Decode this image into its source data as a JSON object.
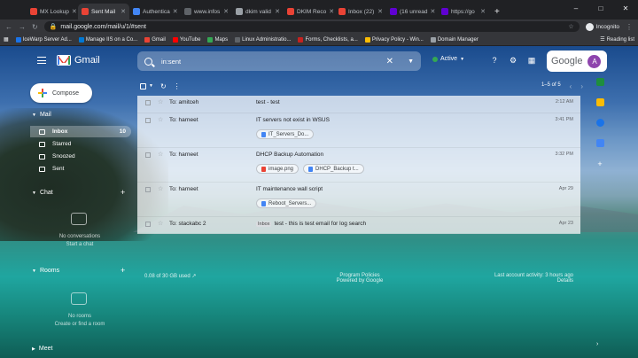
{
  "browser": {
    "tabs": [
      {
        "label": "MX Lookup",
        "color": "#ea4335",
        "active": false
      },
      {
        "label": "Sent Mail",
        "color": "#ea4335",
        "active": true
      },
      {
        "label": "Authentica",
        "color": "#4285f4",
        "active": false
      },
      {
        "label": "www.infos",
        "color": "#5f6368",
        "active": false
      },
      {
        "label": "dkim valid",
        "color": "#9aa0a6",
        "active": false
      },
      {
        "label": "DKIM Reco",
        "color": "#ea4335",
        "active": false
      },
      {
        "label": "Inbox (22)",
        "color": "#ea4335",
        "active": false
      },
      {
        "label": "(16 unread",
        "color": "#6001d2",
        "active": false
      },
      {
        "label": "https://go",
        "color": "#6001d2",
        "active": false
      }
    ],
    "url": "mail.google.com/mail/u/1/#sent",
    "profile": "Incognito",
    "bookmarks": [
      {
        "label": "IceWarp Server Ad...",
        "color": "#1a73e8"
      },
      {
        "label": "Manage IIS on a Co...",
        "color": "#0078d4"
      },
      {
        "label": "Gmail",
        "color": "#ea4335"
      },
      {
        "label": "YouTube",
        "color": "#ff0000"
      },
      {
        "label": "Maps",
        "color": "#34a853"
      },
      {
        "label": "Linux Administratio...",
        "color": "#5f6368"
      },
      {
        "label": "Forms, Checklists, a...",
        "color": "#c5221f"
      },
      {
        "label": "Privacy Policy - Win...",
        "color": "#fbbc04"
      },
      {
        "label": "Domain Manager",
        "color": "#9aa0a6"
      }
    ],
    "reading_list": "Reading list"
  },
  "gmail": {
    "brand": "Gmail",
    "search_query": "in:sent",
    "status": "Active",
    "account_brand": "Google",
    "avatar_letter": "A",
    "compose": "Compose",
    "sections": {
      "mail": "Mail",
      "chat": "Chat",
      "rooms": "Rooms",
      "meet": "Meet"
    },
    "nav": [
      {
        "label": "Inbox",
        "count": "10"
      },
      {
        "label": "Starred",
        "count": ""
      },
      {
        "label": "Snoozed",
        "count": ""
      },
      {
        "label": "Sent",
        "count": ""
      }
    ],
    "chat_empty": "No conversations",
    "chat_link": "Start a chat",
    "rooms_empty": "No rooms",
    "rooms_link": "Create or find a room",
    "pager": "1–5 of 5",
    "emails": [
      {
        "to": "To: amitceh",
        "subject": "test - test",
        "label": "",
        "date": "2:12 AM",
        "attachments": []
      },
      {
        "to": "To: harneet",
        "subject": "IT servers not exist in WSUS",
        "label": "",
        "date": "3:41 PM",
        "attachments": [
          {
            "name": "IT_Servers_Do...",
            "color": "#4285f4"
          }
        ]
      },
      {
        "to": "To: harneet",
        "subject": "DHCP Backup Automation",
        "label": "",
        "date": "3:32 PM",
        "attachments": [
          {
            "name": "image.png",
            "color": "#ea4335"
          },
          {
            "name": "DHCP_Backup t...",
            "color": "#4285f4"
          }
        ]
      },
      {
        "to": "To: harneet",
        "subject": "IT maintenance wall script",
        "label": "",
        "date": "Apr 29",
        "attachments": [
          {
            "name": "Reboot_Servers...",
            "color": "#4285f4"
          }
        ]
      },
      {
        "to": "To: stackabc 2",
        "subject": "test - this is test email for log search",
        "label": "Inbox",
        "date": "Apr 23",
        "attachments": []
      }
    ],
    "storage": "0.08 of 30 GB used",
    "policies_1": "Program Policies",
    "policies_2": "Powered by Google",
    "activity_1": "Last account activity: 3 hours ago",
    "activity_2": "Details"
  }
}
